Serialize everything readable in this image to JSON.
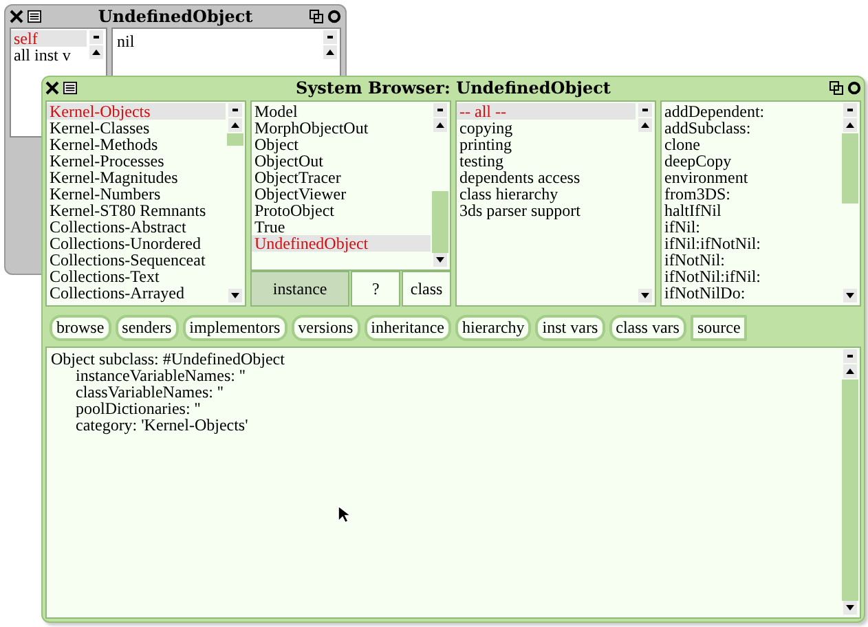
{
  "inspector": {
    "title": "UndefinedObject",
    "fields": [
      {
        "label": "self",
        "selected": true
      },
      {
        "label": "all inst v",
        "selected": false
      }
    ],
    "value": "nil"
  },
  "browser": {
    "title": "System Browser: UndefinedObject",
    "categories": [
      {
        "label": "Kernel-Objects",
        "selected": true
      },
      {
        "label": "Kernel-Classes",
        "selected": false
      },
      {
        "label": "Kernel-Methods",
        "selected": false
      },
      {
        "label": "Kernel-Processes",
        "selected": false
      },
      {
        "label": "Kernel-Magnitudes",
        "selected": false
      },
      {
        "label": "Kernel-Numbers",
        "selected": false
      },
      {
        "label": "Kernel-ST80 Remnants",
        "selected": false
      },
      {
        "label": "Collections-Abstract",
        "selected": false
      },
      {
        "label": "Collections-Unordered",
        "selected": false
      },
      {
        "label": "Collections-Sequenceat",
        "selected": false
      },
      {
        "label": "Collections-Text",
        "selected": false
      },
      {
        "label": "Collections-Arrayed",
        "selected": false
      }
    ],
    "classes": [
      {
        "label": "Model",
        "selected": false
      },
      {
        "label": "MorphObjectOut",
        "selected": false
      },
      {
        "label": "Object",
        "selected": false
      },
      {
        "label": "ObjectOut",
        "selected": false
      },
      {
        "label": "ObjectTracer",
        "selected": false
      },
      {
        "label": "ObjectViewer",
        "selected": false
      },
      {
        "label": "ProtoObject",
        "selected": false
      },
      {
        "label": "True",
        "selected": false
      },
      {
        "label": "UndefinedObject",
        "selected": true
      }
    ],
    "class_side": [
      {
        "label": "instance",
        "selected": true
      },
      {
        "label": "?",
        "selected": false
      },
      {
        "label": "class",
        "selected": false
      }
    ],
    "protocols": [
      {
        "label": "-- all --",
        "selected": true
      },
      {
        "label": "copying",
        "selected": false
      },
      {
        "label": "printing",
        "selected": false
      },
      {
        "label": "testing",
        "selected": false
      },
      {
        "label": "dependents access",
        "selected": false
      },
      {
        "label": "class hierarchy",
        "selected": false
      },
      {
        "label": "3ds parser support",
        "selected": false
      }
    ],
    "methods": [
      {
        "label": "addDependent:",
        "selected": false
      },
      {
        "label": "addSubclass:",
        "selected": false
      },
      {
        "label": "clone",
        "selected": false
      },
      {
        "label": "deepCopy",
        "selected": false
      },
      {
        "label": "environment",
        "selected": false
      },
      {
        "label": "from3DS:",
        "selected": false
      },
      {
        "label": "haltIfNil",
        "selected": false
      },
      {
        "label": "ifNil:",
        "selected": false
      },
      {
        "label": "ifNil:ifNotNil:",
        "selected": false
      },
      {
        "label": "ifNotNil:",
        "selected": false
      },
      {
        "label": "ifNotNil:ifNil:",
        "selected": false
      },
      {
        "label": "ifNotNilDo:",
        "selected": false
      }
    ],
    "buttons": [
      {
        "label": "browse",
        "kind": "pill"
      },
      {
        "label": "senders",
        "kind": "pill"
      },
      {
        "label": "implementors",
        "kind": "pill"
      },
      {
        "label": "versions",
        "kind": "pill"
      },
      {
        "label": "inheritance",
        "kind": "pill"
      },
      {
        "label": "hierarchy",
        "kind": "pill"
      },
      {
        "label": "inst vars",
        "kind": "pill"
      },
      {
        "label": "class vars",
        "kind": "pill"
      },
      {
        "label": "source",
        "kind": "square"
      }
    ],
    "code": "Object subclass: #UndefinedObject\n      instanceVariableNames: ''\n      classVariableNames: ''\n      poolDictionaries: ''\n      category: 'Kernel-Objects'"
  }
}
